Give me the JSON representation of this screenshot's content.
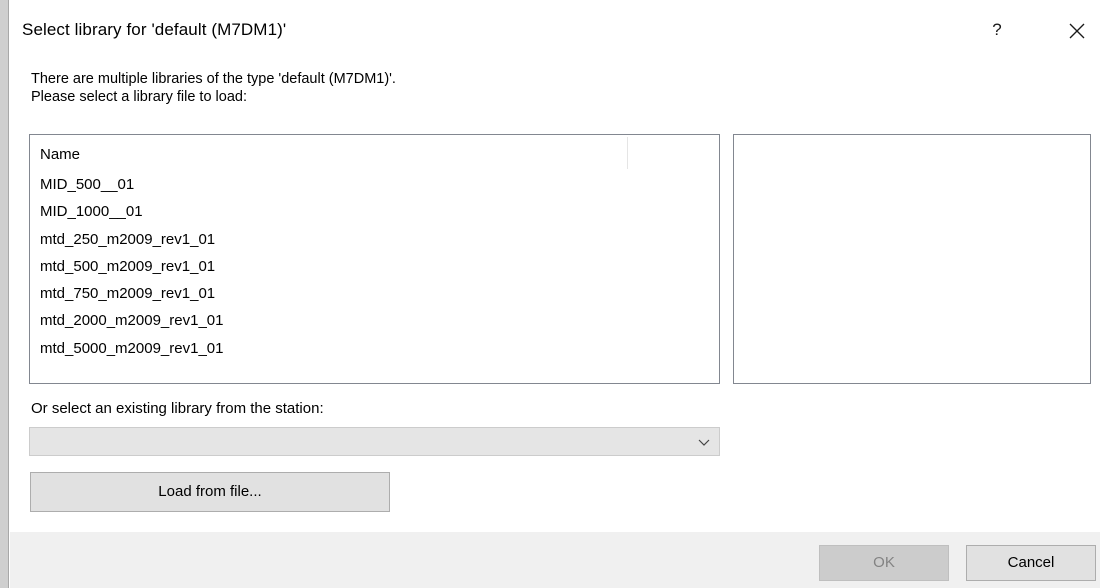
{
  "dialog": {
    "title": "Select library for 'default (M7DM1)'",
    "help_label": "?",
    "close_icon": "close-icon"
  },
  "intro": {
    "line1": "There are multiple libraries of the type 'default (M7DM1)'.",
    "line2": "Please select a library file to load:"
  },
  "library_list": {
    "column_header": "Name",
    "rows": [
      "MID_500__01",
      "MID_1000__01",
      "mtd_250_m2009_rev1_01",
      "mtd_500_m2009_rev1_01",
      "mtd_750_m2009_rev1_01",
      "mtd_2000_m2009_rev1_01",
      "mtd_5000_m2009_rev1_01"
    ]
  },
  "station": {
    "label": "Or select an existing library from the station:",
    "selected_value": "",
    "dropdown_icon": "chevron-down-icon"
  },
  "buttons": {
    "load_from_file": "Load from file...",
    "ok": "OK",
    "cancel": "Cancel"
  },
  "colors": {
    "footer_bg": "#f0f0f0",
    "button_bg": "#e1e1e1",
    "disabled_button_bg": "#cccccc",
    "disabled_text": "#838383",
    "border": "#828790"
  }
}
